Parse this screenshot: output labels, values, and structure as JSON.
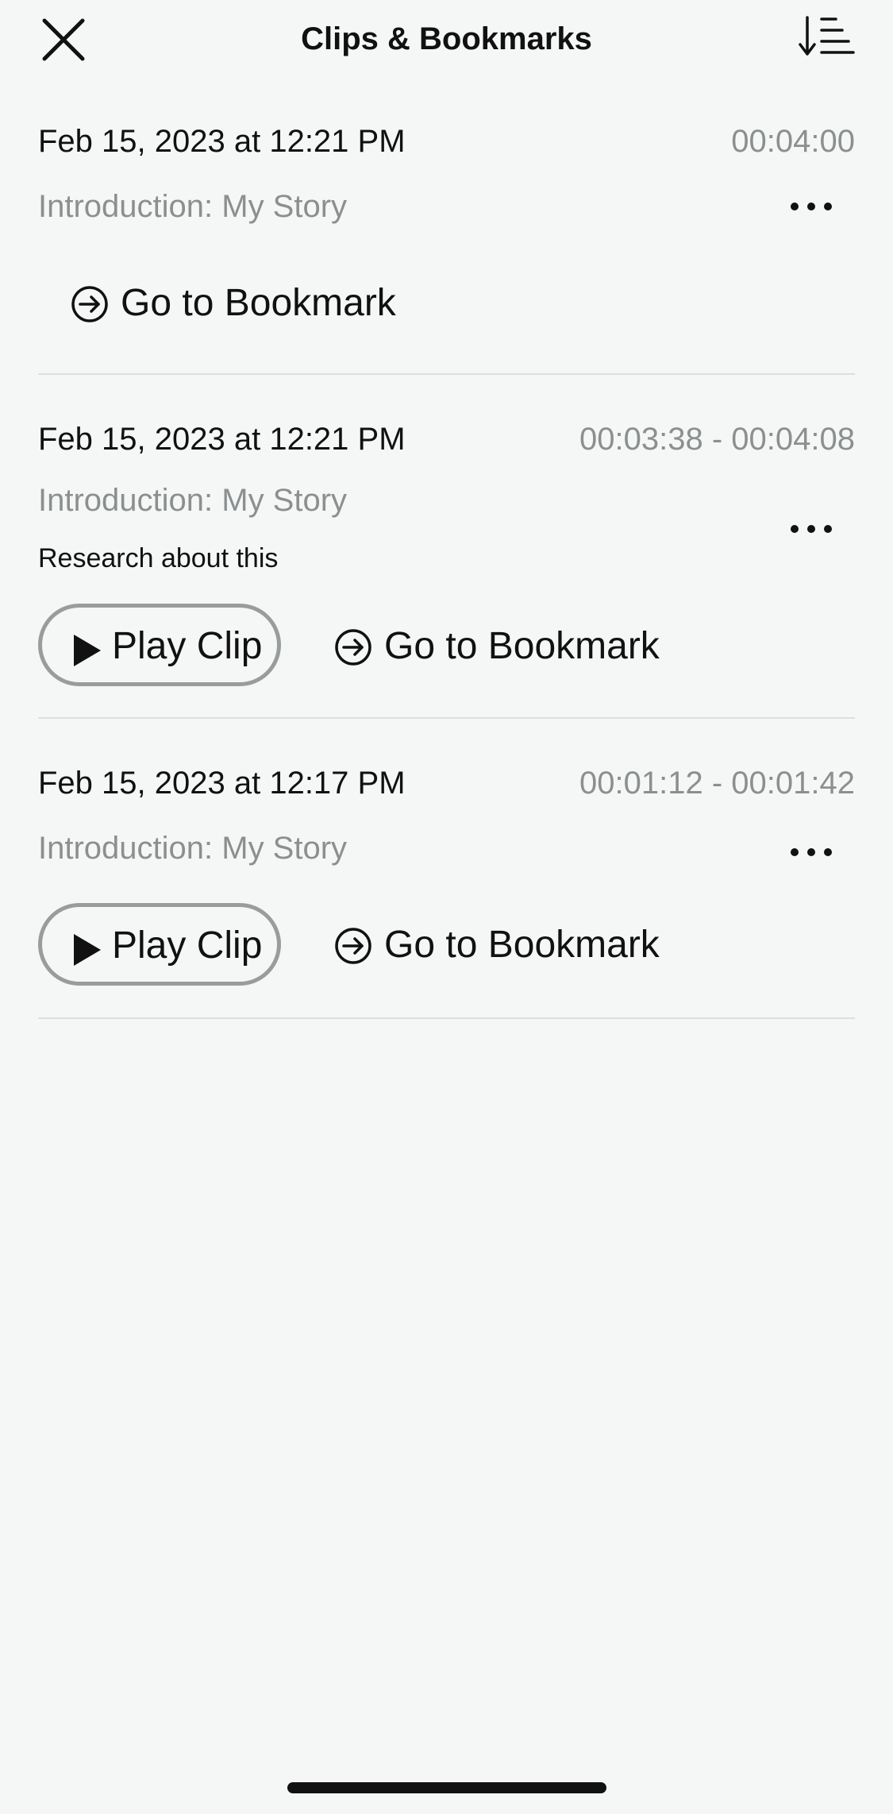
{
  "header": {
    "title": "Clips & Bookmarks",
    "close_icon": "close-icon",
    "sort_icon": "sort-descending-icon"
  },
  "entries": [
    {
      "date": "Feb 15, 2023 at 12:21 PM",
      "time": "00:04:00",
      "chapter": "Introduction: My Story",
      "note": "",
      "has_clip": false,
      "goto_label": "Go to Bookmark"
    },
    {
      "date": "Feb 15, 2023 at 12:21 PM",
      "time": "00:03:38 - 00:04:08",
      "chapter": "Introduction: My Story",
      "note": "Research about this",
      "has_clip": true,
      "play_label": "Play Clip",
      "goto_label": "Go to Bookmark"
    },
    {
      "date": "Feb 15, 2023 at 12:17 PM",
      "time": "00:01:12 - 00:01:42",
      "chapter": "Introduction: My Story",
      "note": "",
      "has_clip": true,
      "play_label": "Play Clip",
      "goto_label": "Go to Bookmark"
    }
  ],
  "colors": {
    "background": "#f5f7f6",
    "text_primary": "#111111",
    "text_secondary": "#8c8f90",
    "divider": "#dcdfdf",
    "pill_border": "#999c9d"
  }
}
